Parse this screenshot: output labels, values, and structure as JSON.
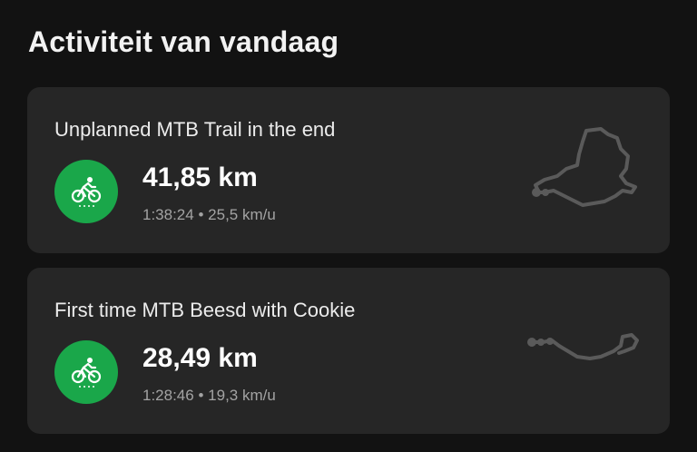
{
  "header": {
    "title": "Activiteit van vandaag"
  },
  "activities": [
    {
      "title": "Unplanned MTB Trail in the end",
      "icon": "cycling-icon",
      "distance": "41,85 km",
      "duration": "1:38:24",
      "separator": "•",
      "speed": "25,5 km/u"
    },
    {
      "title": "First time MTB Beesd with Cookie",
      "icon": "cycling-icon",
      "distance": "28,49 km",
      "duration": "1:28:46",
      "separator": "•",
      "speed": "19,3 km/u"
    }
  ],
  "colors": {
    "background": "#121212",
    "card": "#262626",
    "accent": "#1aa74a",
    "route": "#5a5a5a"
  }
}
